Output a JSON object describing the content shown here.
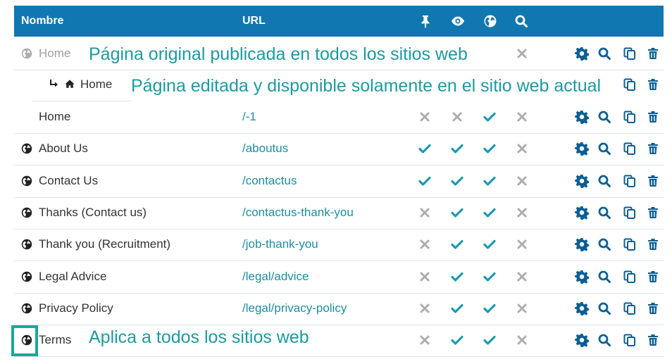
{
  "header": {
    "name": "Nombre",
    "url": "URL"
  },
  "rows": [
    {
      "name": "Home",
      "url": "",
      "flags": []
    },
    {
      "name": "Home",
      "url": "/-1",
      "flags": [
        "x",
        "x",
        "check",
        "x"
      ]
    },
    {
      "name": "About Us",
      "url": "/aboutus",
      "flags": [
        "check",
        "check",
        "check",
        "x"
      ]
    },
    {
      "name": "Contact Us",
      "url": "/contactus",
      "flags": [
        "check",
        "check",
        "check",
        "x"
      ]
    },
    {
      "name": "Thanks (Contact us)",
      "url": "/contactus-thank-you",
      "flags": [
        "x",
        "check",
        "check",
        "x"
      ]
    },
    {
      "name": "Thank you (Recruitment)",
      "url": "/job-thank-you",
      "flags": [
        "x",
        "check",
        "check",
        "x"
      ]
    },
    {
      "name": "Legal Advice",
      "url": "/legal/advice",
      "flags": [
        "x",
        "check",
        "check",
        "x"
      ]
    },
    {
      "name": "Privacy Policy",
      "url": "/legal/privacy-policy",
      "flags": [
        "x",
        "check",
        "check",
        "x"
      ]
    },
    {
      "name": "Terms",
      "url": "",
      "flags": [
        "x",
        "check",
        "check",
        "x"
      ]
    }
  ],
  "sub_row": {
    "label": "Home"
  },
  "annotations": {
    "original": "Página original publicada en todos los sitios web",
    "edited": "Página editada y disponible solamente en el sitio web actual",
    "all_sites": "Aplica a todos los sitios web"
  },
  "colors": {
    "header": "#1177b0",
    "accent": "#1b8fa0",
    "check": "#1b9bb0",
    "x": "#a9aeb2",
    "annotation": "#1e9aa0"
  }
}
